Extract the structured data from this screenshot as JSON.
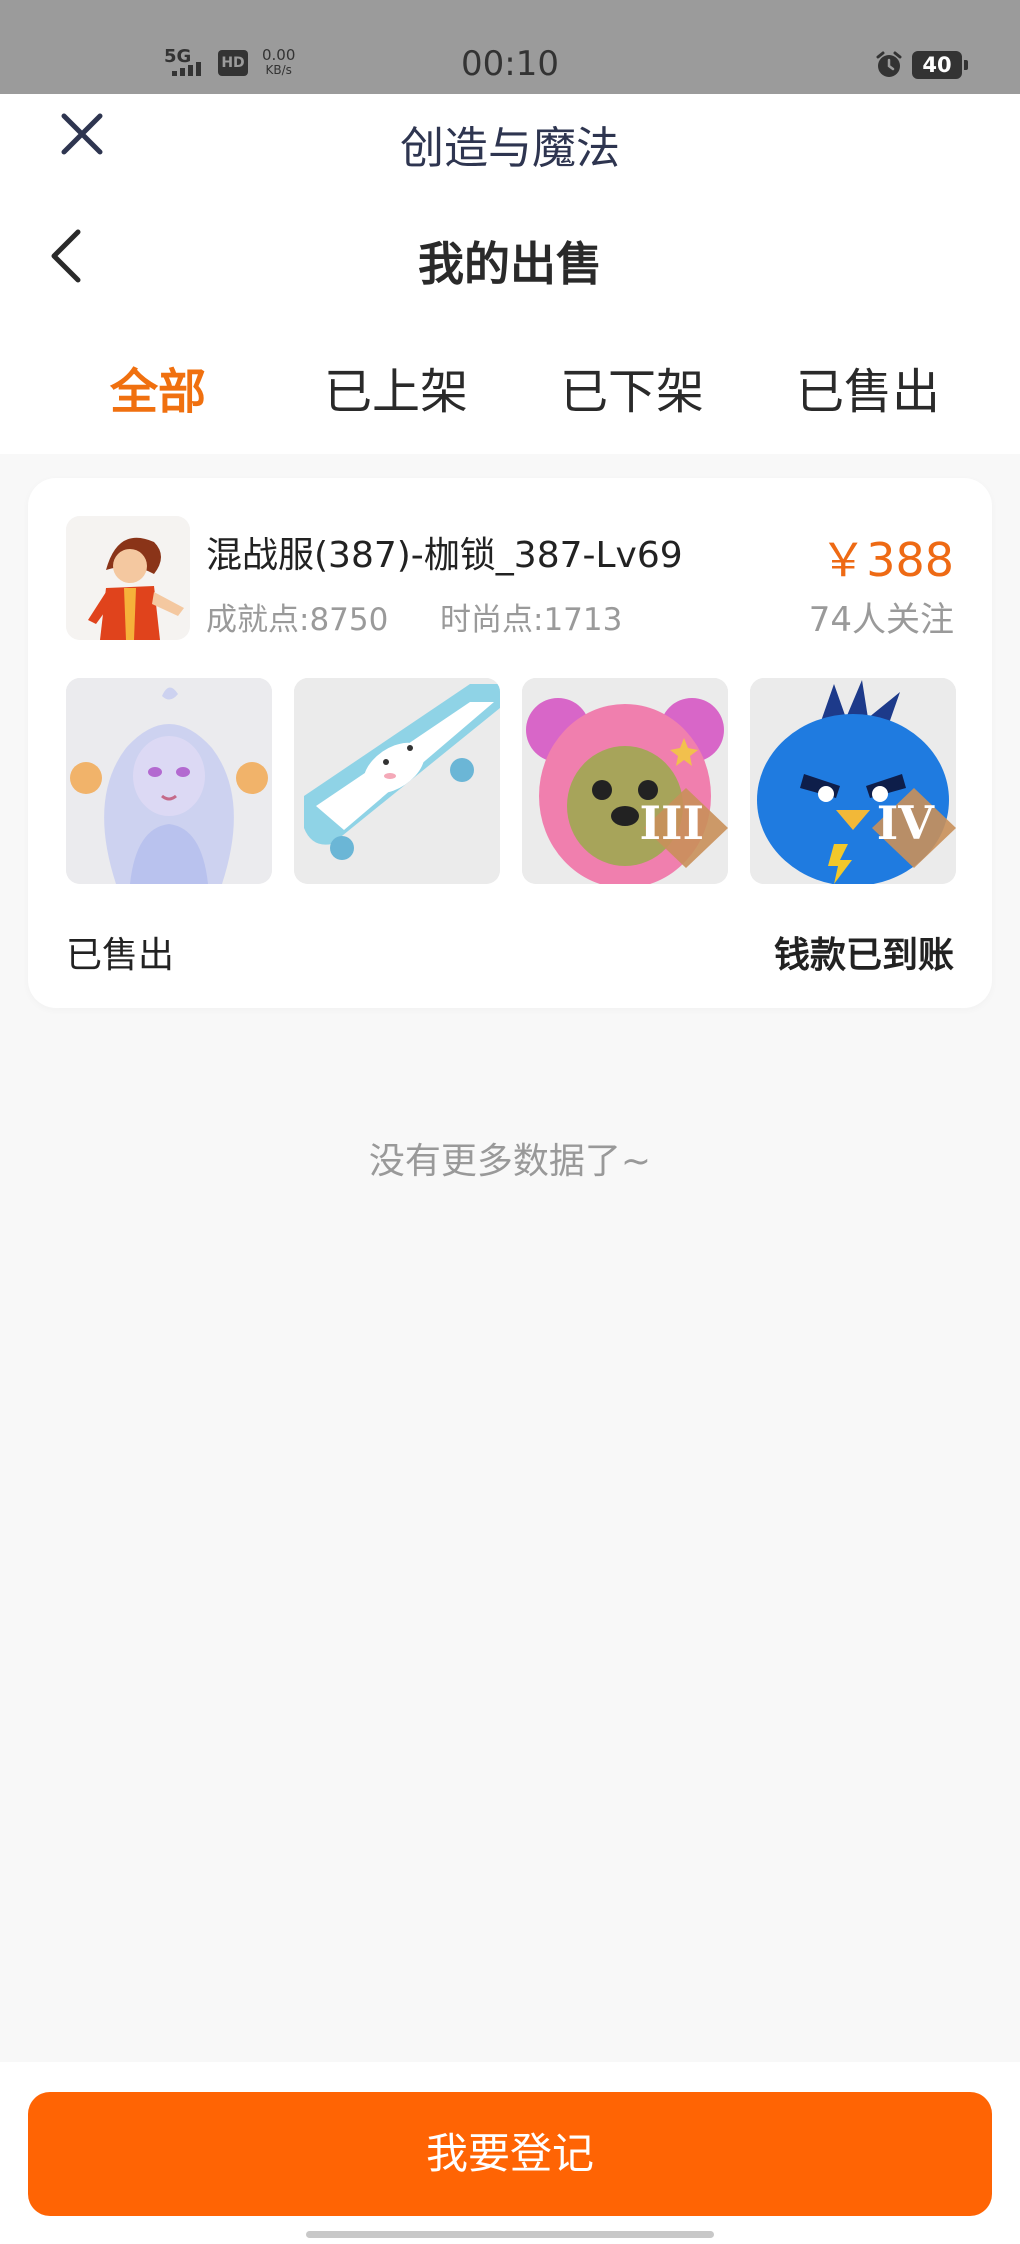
{
  "status_bar": {
    "network": "5G",
    "hd": "HD",
    "speed_value": "0.00",
    "speed_unit": "KB/s",
    "time": "00:10",
    "battery": "40"
  },
  "header": {
    "app_title": "创造与魔法",
    "page_title": "我的出售"
  },
  "tabs": [
    {
      "label": "全部",
      "active": true
    },
    {
      "label": "已上架",
      "active": false
    },
    {
      "label": "已下架",
      "active": false
    },
    {
      "label": "已售出",
      "active": false
    }
  ],
  "listing": {
    "name": "混战服(387)-枷锁_387-Lv69",
    "achievement": "成就点:8750",
    "fashion": "时尚点:1713",
    "price": "￥388",
    "followers": "74人关注",
    "items": [
      {
        "icon": "white-spirit-character-icon"
      },
      {
        "icon": "bunny-skateboard-icon"
      },
      {
        "icon": "pink-bear-mount-icon",
        "rank": "III"
      },
      {
        "icon": "blue-bird-mount-icon",
        "rank": "IV"
      }
    ],
    "sale_status": "已售出",
    "payment_status": "钱款已到账"
  },
  "footer_text": "没有更多数据了~",
  "action": {
    "register_label": "我要登记"
  },
  "colors": {
    "accent": "#f0700f",
    "button": "#ff6404",
    "price": "#ee6a14"
  }
}
